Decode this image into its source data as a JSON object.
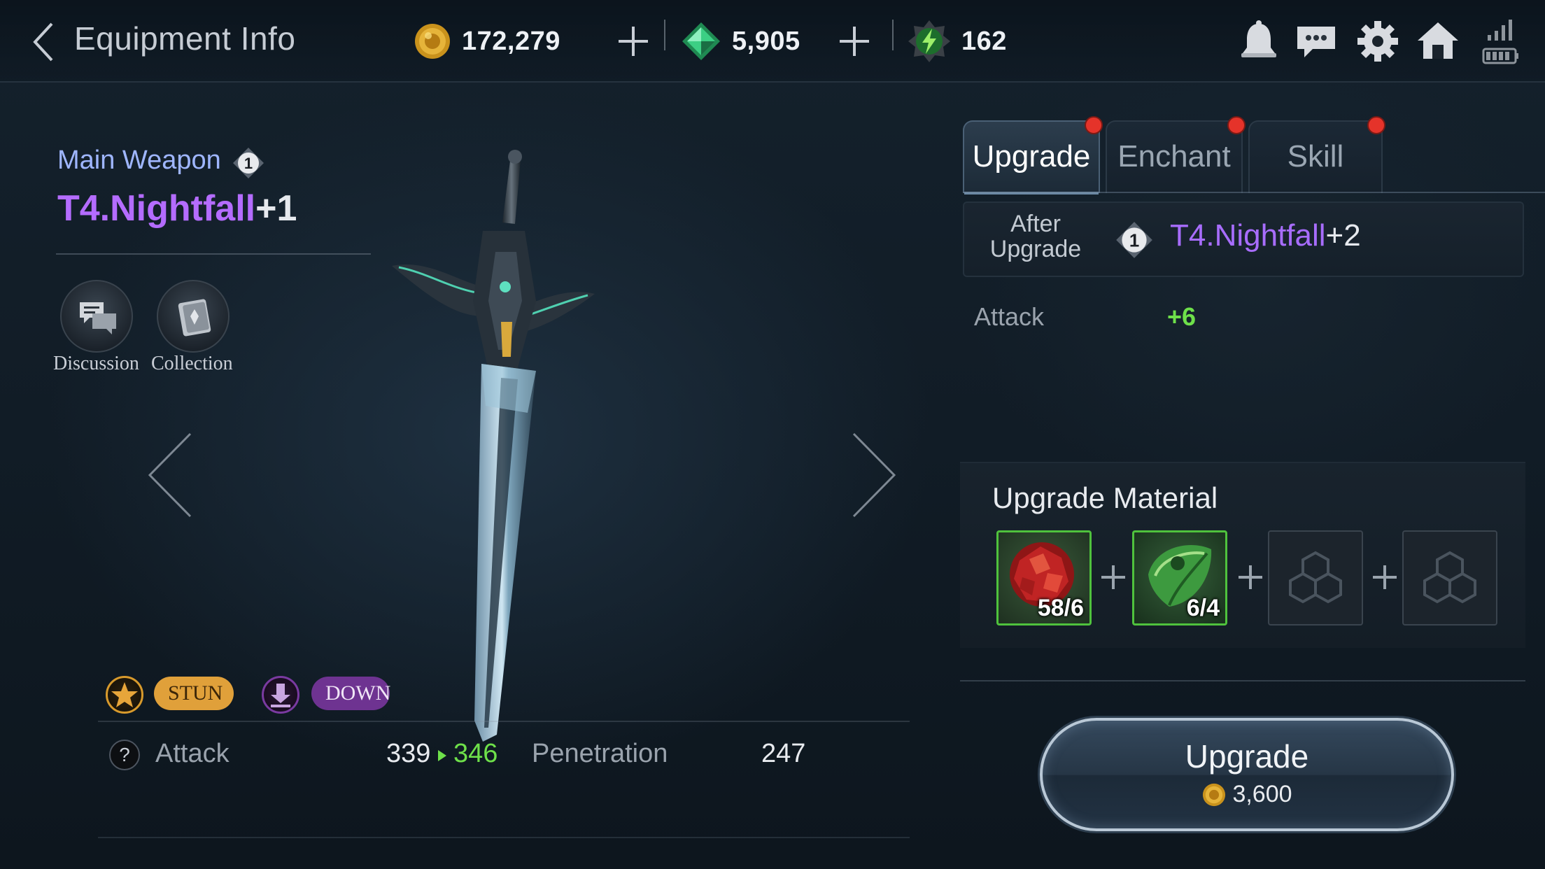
{
  "header": {
    "title": "Equipment Info",
    "currencies": [
      {
        "name": "gold",
        "value": "172,279",
        "icon": "gold-coin-icon"
      },
      {
        "name": "gem",
        "value": "5,905",
        "icon": "green-gem-icon"
      },
      {
        "name": "energy",
        "value": "162",
        "icon": "energy-icon"
      }
    ],
    "icons": [
      "bell-icon",
      "chat-icon",
      "gear-icon",
      "home-icon",
      "signal-battery-icon"
    ]
  },
  "item": {
    "slot": "Main Weapon",
    "tier_badge": "1",
    "name": "T4.Nightfall",
    "level": "+1",
    "buttons": {
      "discussion": "Discussion",
      "collection": "Collection"
    },
    "effects": [
      {
        "label": "STUN",
        "icon": "star-icon",
        "color": "#e7a53a"
      },
      {
        "label": "DOWN",
        "icon": "down-arrow-icon",
        "color": "#7a3aa0"
      }
    ],
    "stats": {
      "attack_label": "Attack",
      "attack_current": "339",
      "attack_next": "346",
      "penetration_label": "Penetration",
      "penetration_value": "247"
    }
  },
  "tabs": [
    {
      "label": "Upgrade",
      "active": true
    },
    {
      "label": "Enchant",
      "active": false
    },
    {
      "label": "Skill",
      "active": false
    }
  ],
  "after_upgrade": {
    "label_line1": "After",
    "label_line2": "Upgrade",
    "tier_badge": "1",
    "name": "T4.Nightfall",
    "level": "+2",
    "attack_label": "Attack",
    "attack_delta": "+6"
  },
  "materials": {
    "title": "Upgrade Material",
    "slots": [
      {
        "count": "58/6",
        "kind": "red-ore-icon"
      },
      {
        "count": "6/4",
        "kind": "green-leaf-icon"
      },
      {
        "count": "",
        "kind": "empty-slot-icon"
      },
      {
        "count": "",
        "kind": "empty-slot-icon"
      }
    ]
  },
  "upgrade_button": {
    "label": "Upgrade",
    "cost": "3,600"
  },
  "colors": {
    "accent_purple": "#b46cff",
    "positive_green": "#6ee04a",
    "notify_red": "#e5332a",
    "slot_label": "#9fb6ff"
  }
}
